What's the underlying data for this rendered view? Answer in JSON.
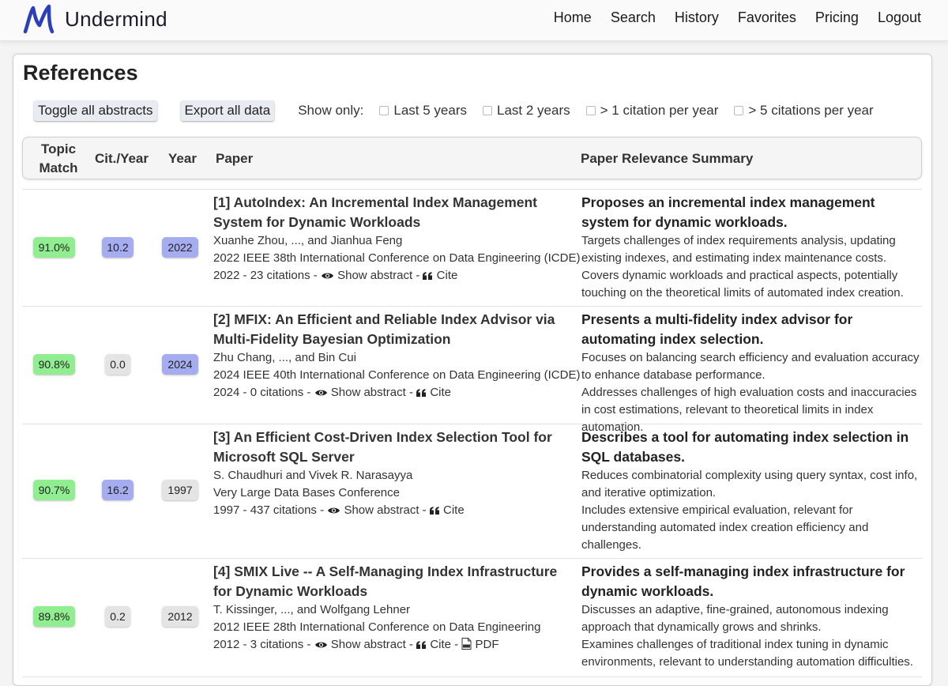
{
  "app": {
    "name": "Undermind"
  },
  "nav": [
    "Home",
    "Search",
    "History",
    "Favorites",
    "Pricing",
    "Logout"
  ],
  "panel": {
    "title": "References"
  },
  "controls": {
    "toggle_abstracts": "Toggle all abstracts",
    "export": "Export all data",
    "show_only": "Show only:",
    "filters": [
      "Last 5 years",
      "Last 2 years",
      "> 1 citation per year",
      "> 5 citations per year"
    ]
  },
  "table": {
    "headers": {
      "topic_match_1": "Topic",
      "topic_match_2": "Match",
      "cit_year": "Cit./Year",
      "year": "Year",
      "paper": "Paper",
      "summary": "Paper Relevance Summary"
    },
    "rows": [
      {
        "match": "91.0%",
        "cit": "10.2",
        "year": "2022",
        "title": "[1] AutoIndex: An Incremental Index Management System for Dynamic Workloads",
        "authors": "Xuanhe Zhou, ..., and Jianhua Feng",
        "venue": "2022 IEEE 38th International Conference on Data Engineering (ICDE)",
        "stats": "2022 - 23 citations -",
        "show_abstract": "Show abstract",
        "cite": "Cite",
        "pdf": null,
        "summary_title": "Proposes an incremental index management system for dynamic workloads.",
        "summary_lines": [
          "Targets challenges of index requirements analysis, updating existing indexes, and estimating index maintenance costs.",
          "Covers dynamic workloads and practical aspects, potentially touching on the theoretical limits of automated index creation."
        ]
      },
      {
        "match": "90.8%",
        "cit": "0.0",
        "year": "2024",
        "title": "[2] MFIX: An Efficient and Reliable Index Advisor via Multi-Fidelity Bayesian Optimization",
        "authors": "Zhu Chang, ..., and Bin Cui",
        "venue": "2024 IEEE 40th International Conference on Data Engineering (ICDE)",
        "stats": "2024 - 0 citations -",
        "show_abstract": "Show abstract",
        "cite": "Cite",
        "pdf": null,
        "summary_title": "Presents a multi-fidelity index advisor for automating index selection.",
        "summary_lines": [
          "Focuses on balancing search efficiency and evaluation accuracy to enhance database performance.",
          "Addresses challenges of high evaluation costs and inaccuracies in cost estimations, relevant to theoretical limits in index automation."
        ]
      },
      {
        "match": "90.7%",
        "cit": "16.2",
        "year": "1997",
        "title": "[3] An Efficient Cost-Driven Index Selection Tool for Microsoft SQL Server",
        "authors": "S. Chaudhuri and Vivek R. Narasayya",
        "venue": "Very Large Data Bases Conference",
        "stats": "1997 - 437 citations -",
        "show_abstract": "Show abstract",
        "cite": "Cite",
        "pdf": null,
        "summary_title": "Describes a tool for automating index selection in SQL databases.",
        "summary_lines": [
          "Reduces combinatorial complexity using query syntax, cost info, and iterative optimization.",
          "Includes extensive empirical evaluation, relevant for understanding automated index creation efficiency and challenges."
        ]
      },
      {
        "match": "89.8%",
        "cit": "0.2",
        "year": "2012",
        "title": "[4] SMIX Live -- A Self-Managing Index Infrastructure for Dynamic Workloads",
        "authors": "T. Kissinger, ..., and Wolfgang Lehner",
        "venue": "2012 IEEE 28th International Conference on Data Engineering",
        "stats": "2012 - 3 citations -",
        "show_abstract": "Show abstract",
        "cite": "Cite",
        "pdf": "PDF",
        "summary_title": "Provides a self-managing index infrastructure for dynamic workloads.",
        "summary_lines": [
          "Discusses an adaptive, fine-grained, autonomous indexing approach that dynamically grows and shrinks.",
          "Examines challenges of traditional index tuning in dynamic environments, relevant to understanding automation difficulties."
        ]
      }
    ]
  },
  "colors": {
    "match_badge": "#90ee90",
    "cit_high": "#a6acf0",
    "cit_low": "#e4e4e4",
    "brand_blue": "#2a3fb8"
  },
  "icons": [
    "logo-icon",
    "eye-icon",
    "quote-icon",
    "pdf-icon",
    "checkbox"
  ]
}
